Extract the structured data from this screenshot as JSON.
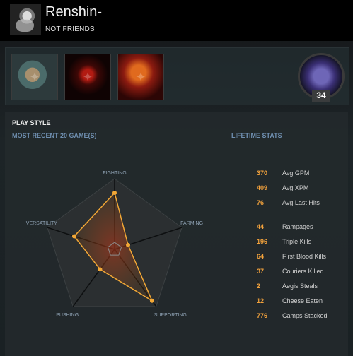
{
  "player": {
    "name": "Renshin-",
    "status": "NOT FRIENDS"
  },
  "medal": {
    "rank_number": "34"
  },
  "section": {
    "title": "PLAY STYLE",
    "recent_label": "MOST RECENT 20 GAME(S)",
    "lifetime_label": "LIFETIME STATS"
  },
  "chart_data": {
    "type": "radar",
    "axes": [
      "FIGHTING",
      "FARMING",
      "SUPPORTING",
      "PUSHING",
      "VERSATILITY"
    ],
    "values": [
      0.8,
      0.2,
      0.9,
      0.35,
      0.6
    ],
    "colors": {
      "fill": "#a85a14",
      "line": "#f3a836"
    }
  },
  "avg_stats": [
    {
      "value": "370",
      "label": "Avg GPM"
    },
    {
      "value": "409",
      "label": "Avg XPM"
    },
    {
      "value": "76",
      "label": "Avg Last Hits"
    }
  ],
  "other_stats": [
    {
      "value": "44",
      "label": "Rampages"
    },
    {
      "value": "196",
      "label": "Triple Kills"
    },
    {
      "value": "64",
      "label": "First Blood Kills"
    },
    {
      "value": "37",
      "label": "Couriers Killed"
    },
    {
      "value": "2",
      "label": "Aegis Steals"
    },
    {
      "value": "12",
      "label": "Cheese Eaten"
    },
    {
      "value": "776",
      "label": "Camps Stacked"
    }
  ]
}
